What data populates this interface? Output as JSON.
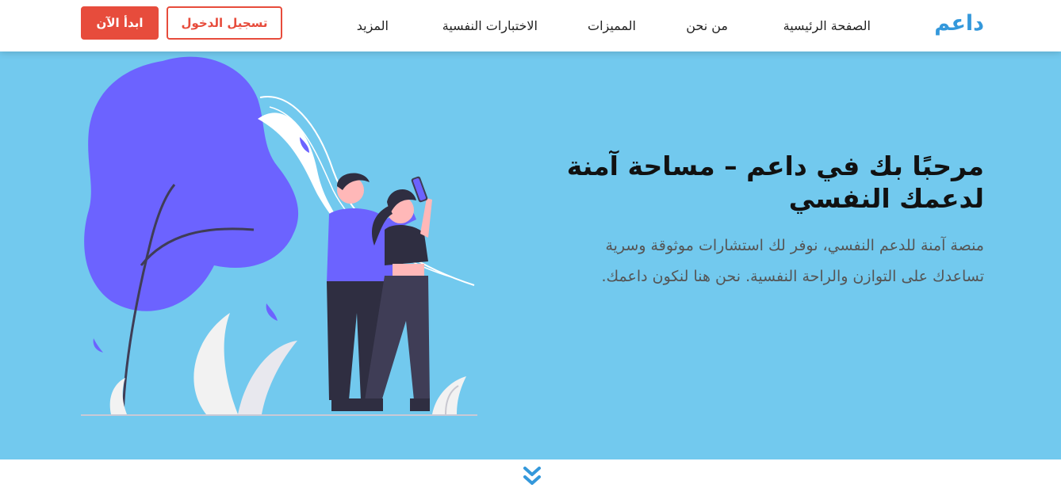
{
  "brand": {
    "name": "داعم"
  },
  "nav": {
    "items": [
      {
        "label": "الصفحة الرئيسية"
      },
      {
        "label": "من نحن"
      },
      {
        "label": "المميزات"
      },
      {
        "label": "الاختبارات النفسية"
      },
      {
        "label": "المزيد"
      }
    ],
    "login_label": "تسجيل الدخول",
    "start_label": "ابدأ الآن"
  },
  "hero": {
    "title": "مرحبًا بك في داعم – مساحة آمنة لدعمك النفسي",
    "description": "منصة آمنة للدعم النفسي، نوفر لك استشارات موثوقة وسرية تساعدك على التوازن والراحة النفسية. نحن هنا لنكون داعمك."
  },
  "colors": {
    "brand": "#3498db",
    "hero_bg": "#72c9ee",
    "accent_red": "#e74c3c",
    "illustration_purple": "#6c63ff"
  },
  "icons": {
    "scroll": "double-chevron-down-icon"
  }
}
